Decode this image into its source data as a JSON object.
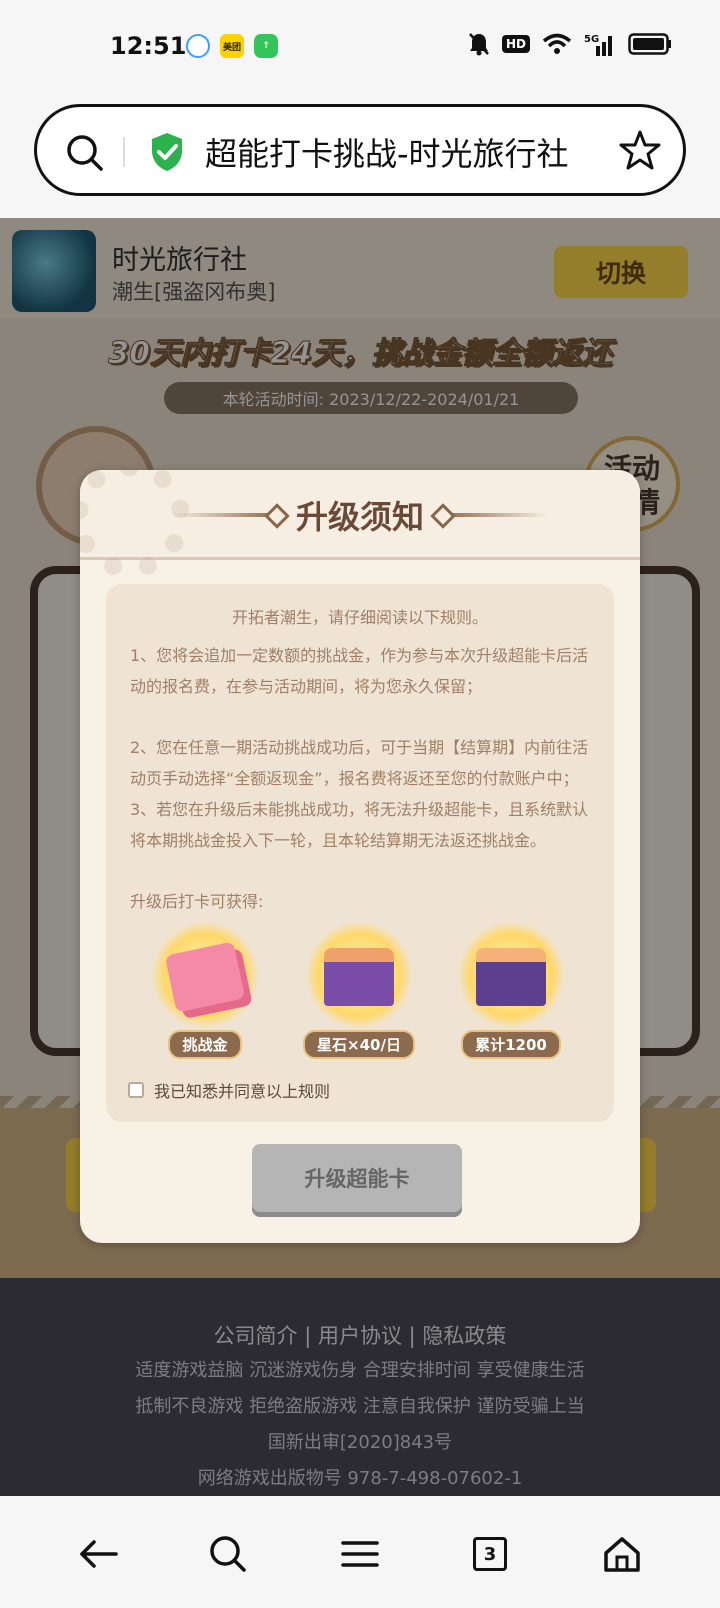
{
  "status_bar": {
    "time": "12:51",
    "hd": "HD",
    "network": "5G",
    "app_badges": [
      "qq-browser-icon",
      "美团",
      "upload-icon"
    ]
  },
  "address_bar": {
    "title": "超能打卡挑战-时光旅行社"
  },
  "app_header": {
    "name": "时光旅行社",
    "sub": "潮生[强盗冈布奥]",
    "switch_label": "切换"
  },
  "banner": {
    "text": "30天内打卡24天，挑战金额全额返还",
    "period": "本轮活动时间: 2023/12/22-2024/01/21",
    "detail_label": "活动\n详情",
    "partial_name": "开拓者潮生"
  },
  "modal": {
    "title": "升级须知",
    "intro": "开拓者潮生，请仔细阅读以下规则。",
    "rules": [
      "1、您将会追加一定数额的挑战金，作为参与本次升级超能卡后活动的报名费，在参与活动期间，将为您永久保留；",
      "2、您在任意一期活动挑战成功后，可于当期【结算期】内前往活动页手动选择“全额返现金”，报名费将返还至您的付款账户中；",
      "3、若您在升级后未能挑战成功，将无法升级超能卡，且系统默认将本期挑战金投入下一轮，且本轮结算期无法返还挑战金。"
    ],
    "rewards_heading": "升级后打卡可获得:",
    "rewards": [
      {
        "label": "挑战金",
        "icon": "money-stack-icon"
      },
      {
        "label": "星石×40/日",
        "icon": "treasure-chest-icon"
      },
      {
        "label": "累计1200",
        "icon": "treasure-chest-icon"
      }
    ],
    "agree_text": "我已知悉并同意以上规则",
    "agree_checked": false,
    "button_label": "升级超能卡"
  },
  "footer": {
    "links": "公司简介 | 用户协议 | 隐私政策",
    "lines": [
      "适度游戏益脑 沉迷游戏伤身 合理安排时间 享受健康生活",
      "抵制不良游戏 拒绝盗版游戏 注意自我保护 谨防受骗上当",
      "国新出审[2020]843号",
      "网络游戏出版物号 978-7-498-07602-1"
    ]
  },
  "bottom_nav": {
    "tabs_count": "3"
  },
  "colors": {
    "accent_yellow": "#ffd84a",
    "modal_bg": "#f8f1e6",
    "rule_text": "#a07f66",
    "button_disabled": "#b5b5b5"
  }
}
